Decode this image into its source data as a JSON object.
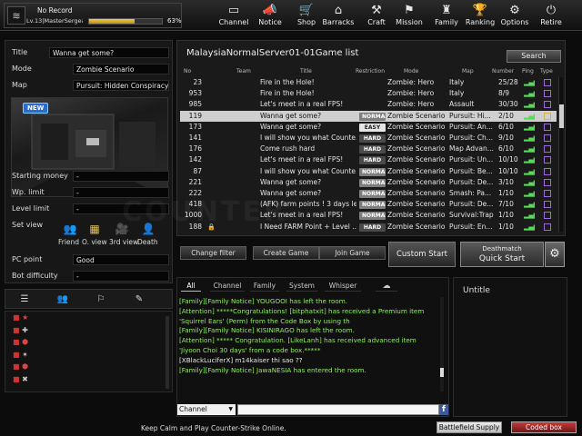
{
  "colors": {
    "exp_bar": "#e0b030",
    "ping_good": "#5d5",
    "chat_notice": "#8ef05a",
    "coded_box": "#b52a2a"
  },
  "profile": {
    "record": "No Record",
    "level": "Lv.13|MasterSergea...",
    "exp_percent": "63%",
    "exp_value": 0.63,
    "rank_icon": "chevron-rank-icon"
  },
  "nav": [
    {
      "label": "Channel",
      "icon": "monitor-icon",
      "glyph": "▭"
    },
    {
      "label": "Notice",
      "icon": "megaphone-icon",
      "glyph": "📣"
    },
    {
      "label": "Shop",
      "icon": "cart-icon",
      "glyph": "🛒"
    },
    {
      "label": "Barracks",
      "icon": "barracks-icon",
      "glyph": "⌂"
    },
    {
      "label": "Craft",
      "icon": "hammer-icon",
      "glyph": "⚒"
    },
    {
      "label": "Mission",
      "icon": "flag-icon",
      "glyph": "⚑"
    },
    {
      "label": "Family",
      "icon": "family-icon",
      "glyph": "♜"
    },
    {
      "label": "Ranking",
      "icon": "trophy-icon",
      "glyph": "🏆"
    },
    {
      "label": "Options",
      "icon": "gear-icon",
      "glyph": "⚙"
    },
    {
      "label": "Retire",
      "icon": "power-icon",
      "glyph": "⏻"
    }
  ],
  "room_info": {
    "title_label": "Title",
    "title_value": "Wanna get some?",
    "mode_label": "Mode",
    "mode_value": "Zombie Scenario",
    "map_label": "Map",
    "map_value": "Pursuit: Hidden Conspiracy",
    "new_badge": "NEW",
    "starting_money_label": "Starting money",
    "starting_money_value": "-",
    "wp_limit_label": "Wp. limit",
    "wp_limit_value": "-",
    "level_limit_label": "Level limit",
    "level_limit_value": "-",
    "set_view_label": "Set view",
    "views": [
      "Friend",
      "O. view",
      "3rd view",
      "Death"
    ],
    "pc_point_label": "PC point",
    "pc_point_value": "Good",
    "bot_difficulty_label": "Bot difficulty",
    "bot_difficulty_value": "-"
  },
  "side_tabs": [
    "user-list-icon",
    "group-icon",
    "friend-tag-icon",
    "edit-icon"
  ],
  "side_ranks": [
    "★",
    "✚",
    "⬢",
    "✶",
    "⬢",
    "✖"
  ],
  "server": {
    "title": "MalaysiaNormalServer01-01Game list",
    "search_label": "Search",
    "columns": [
      "No",
      "Team",
      "Title",
      "Restriction",
      "Mode",
      "Map",
      "Number",
      "Ping",
      "Type"
    ],
    "rows": [
      {
        "no": "23",
        "title": "Fire in the Hole!",
        "restriction": "",
        "mode": "Zombie: Hero",
        "map": "Italy",
        "number": "25/28"
      },
      {
        "no": "953",
        "title": "Fire in the Hole!",
        "restriction": "",
        "mode": "Zombie: Hero",
        "map": "Italy",
        "number": "8/9"
      },
      {
        "no": "985",
        "title": "Let's meet in a real FPS!",
        "restriction": "",
        "mode": "Zombie: Hero",
        "map": "Assault",
        "number": "30/30"
      },
      {
        "no": "119",
        "title": "Wanna get some?",
        "restriction": "NORMAL",
        "mode": "Zombie Scenario",
        "map": "Pursuit: Hi...",
        "number": "2/10",
        "selected": true
      },
      {
        "no": "173",
        "title": "Wanna get some?",
        "restriction": "EASY",
        "mode": "Zombie Scenario",
        "map": "Pursuit: An...",
        "number": "6/10"
      },
      {
        "no": "141",
        "title": "I will show you what Counte...",
        "restriction": "HARD",
        "mode": "Zombie Scenario",
        "map": "Pursuit: Ch...",
        "number": "9/10"
      },
      {
        "no": "176",
        "title": "Come rush hard",
        "restriction": "HARD",
        "mode": "Zombie Scenario",
        "map": "Map Advan...",
        "number": "6/10"
      },
      {
        "no": "142",
        "title": "Let's meet in a real FPS!",
        "restriction": "HARD",
        "mode": "Zombie Scenario",
        "map": "Pursuit: Un...",
        "number": "10/10"
      },
      {
        "no": "87",
        "title": "I will show you what Counte...",
        "restriction": "NORMAL",
        "mode": "Zombie Scenario",
        "map": "Pursuit: Be...",
        "number": "10/10"
      },
      {
        "no": "221",
        "title": "Wanna get some?",
        "restriction": "NORMAL",
        "mode": "Zombie Scenario",
        "map": "Pursuit: De...",
        "number": "3/10"
      },
      {
        "no": "222",
        "title": "Wanna get some?",
        "restriction": "NORMAL",
        "mode": "Zombie Scenario",
        "map": "Smash: Pa...",
        "number": "1/10"
      },
      {
        "no": "418",
        "title": "(AFK) farm points ! 3 days left",
        "restriction": "NORMAL",
        "mode": "Zombie Scenario",
        "map": "Pursuit: De...",
        "number": "7/10"
      },
      {
        "no": "1000",
        "title": "Let's meet in a real FPS!",
        "restriction": "NORMAL",
        "mode": "Zombie Scenario",
        "map": "Survival:Trap",
        "number": "1/10"
      },
      {
        "no": "188",
        "title": "I Need FARM Point + Level ...",
        "restriction": "HARD",
        "mode": "Zombie Scenario",
        "map": "Pursuit: En...",
        "number": "1/10",
        "locked": true
      }
    ]
  },
  "actions": {
    "change_filter": "Change filter",
    "create_game": "Create Game",
    "join_game": "Join Game",
    "custom_start": "Custom Start",
    "quick_mode": "Deathmatch",
    "quick_start": "Quick Start"
  },
  "chat": {
    "tabs": [
      "All",
      "Channel",
      "Family",
      "System",
      "Whisper"
    ],
    "messages": [
      {
        "text": "[Family][Family Notice] YOUGOOI has left the room.",
        "color": "green"
      },
      {
        "text": "[Attention] *****Congratulations! [bitphatxit] has received a Premium item",
        "color": "green"
      },
      {
        "text": "'Squirrel Ears' (Perm) from the Code Box by using th",
        "color": "green"
      },
      {
        "text": "[Family][Family Notice] KISINIRAGO has left the room.",
        "color": "green"
      },
      {
        "text": "[Attention] ***** Congratulation. [LikeLanh] has received advanced item",
        "color": "green"
      },
      {
        "text": "'Jiyoon Choi 30 days' from a code box.*****",
        "color": "green"
      },
      {
        "text": "[XBlackLuciferX] m14kaiser thi sao ??",
        "color": "white"
      },
      {
        "text": "[Family][Family Notice] JawaNESIA has entered the room.",
        "color": "green"
      }
    ],
    "channel_select": "Channel",
    "input_value": ""
  },
  "room_panel": {
    "title": "Untitle"
  },
  "footer": {
    "message": "Keep Calm and Play Counter-Strike Online.",
    "battlefield_supply": "Battlefield Supply",
    "coded_box": "Coded box"
  }
}
